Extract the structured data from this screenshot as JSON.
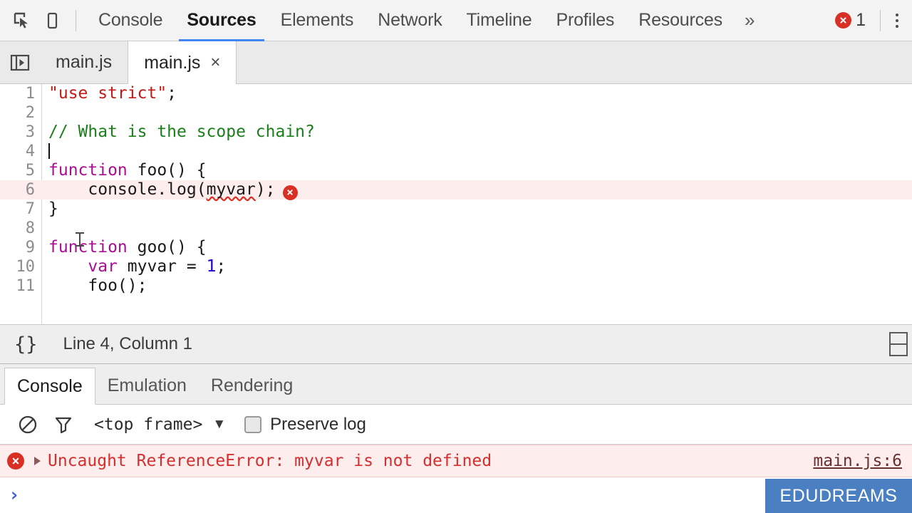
{
  "window": {
    "app": "Chrome DevTools",
    "accent_color": "#4285f4",
    "error_color": "#d93025"
  },
  "toolbar": {
    "inspect_icon": "inspect-element-icon",
    "device_icon": "device-toolbar-icon",
    "tabs": [
      {
        "label": "Console",
        "active": false
      },
      {
        "label": "Sources",
        "active": true
      },
      {
        "label": "Elements",
        "active": false
      },
      {
        "label": "Network",
        "active": false
      },
      {
        "label": "Timeline",
        "active": false
      },
      {
        "label": "Profiles",
        "active": false
      },
      {
        "label": "Resources",
        "active": false
      }
    ],
    "more_tabs_label": "»",
    "error_count": "1",
    "error_icon": "error-circle-icon",
    "menu_icon": "kebab-menu-icon"
  },
  "tabstrip": {
    "nav_toggle_icon": "show-navigator-icon",
    "tabs": [
      {
        "label": "main.js",
        "active": false,
        "closable": false
      },
      {
        "label": "main.js",
        "active": true,
        "closable": true,
        "close_label": "×"
      }
    ]
  },
  "editor": {
    "cursor_icon": "text-cursor-icon",
    "lines": [
      {
        "number": "1",
        "error": false,
        "tokens": [
          {
            "text": "\"use strict\"",
            "type": "str"
          },
          {
            "text": ";",
            "type": "pln"
          }
        ]
      },
      {
        "number": "2",
        "error": false,
        "tokens": []
      },
      {
        "number": "3",
        "error": false,
        "tokens": [
          {
            "text": "// What is the scope chain?",
            "type": "com"
          }
        ]
      },
      {
        "number": "4",
        "error": false,
        "caret": true,
        "tokens": []
      },
      {
        "number": "5",
        "error": false,
        "tokens": [
          {
            "text": "function",
            "type": "kw"
          },
          {
            "text": " foo() {",
            "type": "pln"
          }
        ]
      },
      {
        "number": "6",
        "error": true,
        "error_marker": "inline-error-icon",
        "tokens": [
          {
            "text": "    console.log(",
            "type": "pln"
          },
          {
            "text": "myvar",
            "type": "pln",
            "squiggle": true
          },
          {
            "text": ");",
            "type": "pln"
          }
        ]
      },
      {
        "number": "7",
        "error": false,
        "tokens": [
          {
            "text": "}",
            "type": "pln"
          }
        ]
      },
      {
        "number": "8",
        "error": false,
        "tokens": []
      },
      {
        "number": "9",
        "error": false,
        "tokens": [
          {
            "text": "function",
            "type": "kw"
          },
          {
            "text": " goo() {",
            "type": "pln"
          }
        ]
      },
      {
        "number": "10",
        "error": false,
        "tokens": [
          {
            "text": "    ",
            "type": "pln"
          },
          {
            "text": "var",
            "type": "kw"
          },
          {
            "text": " myvar = ",
            "type": "pln"
          },
          {
            "text": "1",
            "type": "num"
          },
          {
            "text": ";",
            "type": "pln"
          }
        ]
      },
      {
        "number": "11",
        "error": false,
        "tokens": [
          {
            "text": "    foo();",
            "type": "pln"
          }
        ]
      }
    ]
  },
  "statusbar": {
    "format_icon_label": "{}",
    "position": "Line 4, Column 1",
    "split_icon": "split-pane-icon"
  },
  "drawer": {
    "tabs": [
      {
        "label": "Console",
        "active": true
      },
      {
        "label": "Emulation",
        "active": false
      },
      {
        "label": "Rendering",
        "active": false
      }
    ],
    "console_toolbar": {
      "clear_icon": "clear-console-icon",
      "filter_icon": "filter-icon",
      "frame_value": "<top frame>",
      "frame_arrow": "▼",
      "preserve_log_label": "Preserve log",
      "preserve_log_checked": false
    },
    "messages": [
      {
        "level": "error",
        "icon": "error-circle-icon",
        "expander": "expand-triangle-icon",
        "text": "Uncaught ReferenceError: myvar is not defined",
        "source": "main.js:6"
      }
    ],
    "prompt": {
      "chevron": "›",
      "value": "",
      "placeholder": ""
    }
  },
  "watermark": {
    "text": "EDUDREAMS",
    "color": "#4a7fc1"
  }
}
